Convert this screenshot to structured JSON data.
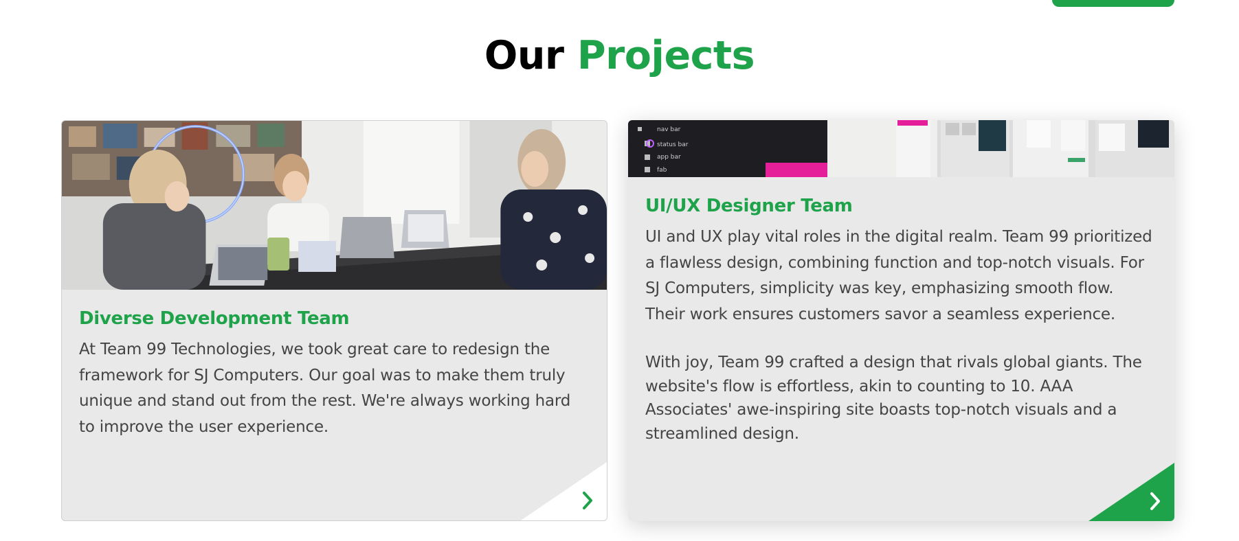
{
  "header": {
    "heading_word1": "Our",
    "heading_word2": "Projects"
  },
  "colors": {
    "accent": "#1fa34a",
    "card_bg": "#e9e9e9",
    "text": "#444444"
  },
  "cards": [
    {
      "title": "Diverse Development Team",
      "paragraph": "At Team 99 Technologies, we took great care to redesign the framework for SJ Computers. Our goal was to make them truly unique and stand out from the rest. We're always working hard to improve the user experience.",
      "image": "team-working-on-laptops-photo",
      "arrow_icon": "chevron-right-icon"
    },
    {
      "title": "UI/UX Designer Team",
      "paragraph": "UI and UX play vital roles in the digital realm. Team 99 prioritized a flawless design, combining function and top-notch visuals. For SJ Computers, simplicity was key, emphasizing smooth flow. Their work ensures customers savor a seamless experience.",
      "paragraph2": "With joy, Team 99 crafted a design that rivals global giants. The website's flow is effortless, akin to counting to 10. AAA Associates' awe-inspiring site boasts top-notch visuals and a streamlined design.",
      "image": "ui-design-screens-photo",
      "image_text": [
        "nav bar",
        "status bar",
        "app bar",
        "fab"
      ],
      "arrow_icon": "chevron-right-icon"
    }
  ]
}
